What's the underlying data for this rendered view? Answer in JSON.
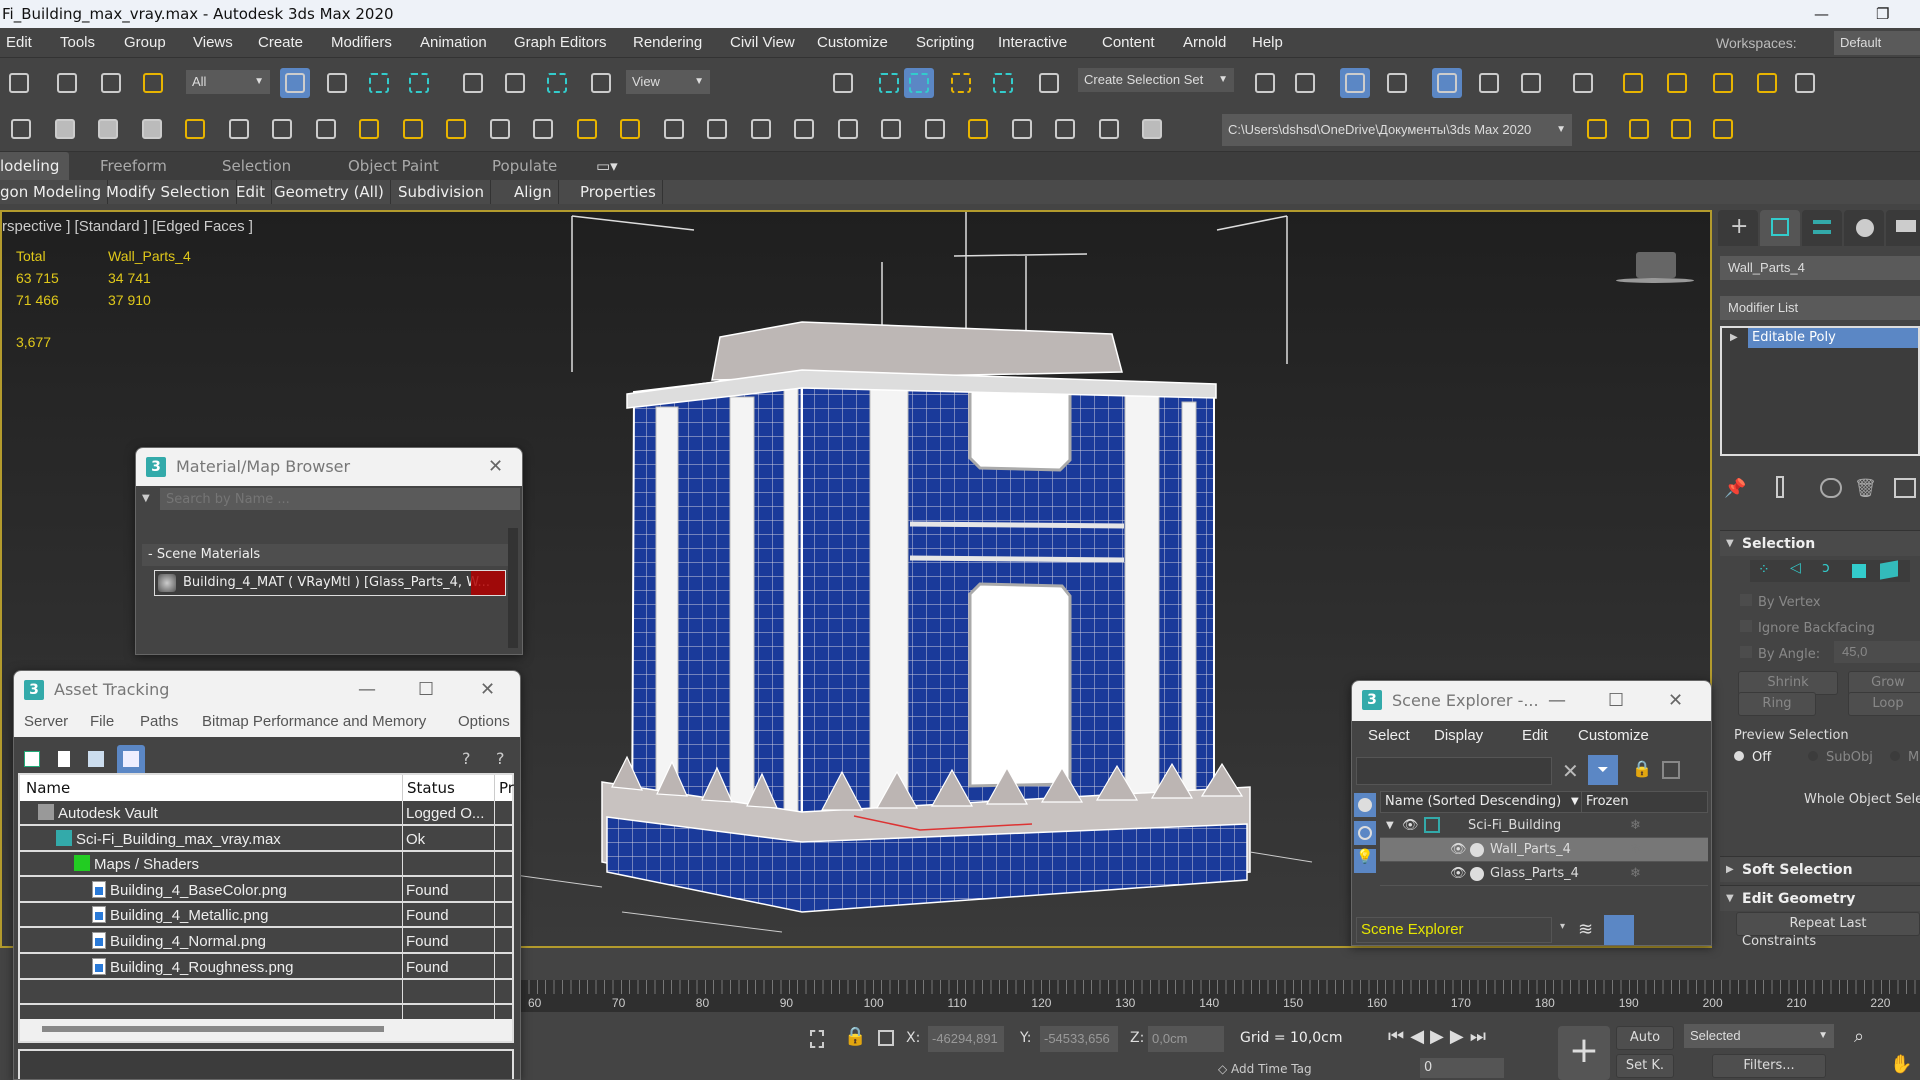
{
  "window": {
    "title": "Fi_Building_max_vray.max - Autodesk 3ds Max 2020",
    "minimize": "—",
    "restore": "❐"
  },
  "menu": [
    "Edit",
    "Tools",
    "Group",
    "Views",
    "Create",
    "Modifiers",
    "Animation",
    "Graph Editors",
    "Rendering",
    "Civil View",
    "Customize",
    "Scripting",
    "Interactive",
    "Content",
    "Arnold",
    "Help"
  ],
  "workspaces": {
    "label": "Workspaces:",
    "value": "Default"
  },
  "toolbar": {
    "selection_filter": "All",
    "ref_coord": "View",
    "named_selection": "Create Selection Set",
    "project_path": "C:\\Users\\dshsd\\OneDrive\\Документы\\3ds Max 2020",
    "row1_icons": [
      "redo-icon",
      "link-icon",
      "unlink-icon",
      "bind-space-warp-icon",
      "select-object-icon",
      "select-by-name-icon",
      "rect-selection-region-icon",
      "window-crossing-icon",
      "move-icon",
      "rotate-icon",
      "scale-icon",
      "placement-icon",
      "pivot-icon",
      "snaps-toggle-icon",
      "angle-snap-icon",
      "percent-snap-icon",
      "spinner-snap-icon",
      "edit-named-sets-icon",
      "mirror-icon",
      "align-icon",
      "scene-explorer-icon",
      "layer-explorer-icon",
      "ribbon-toggle-icon",
      "curve-editor-icon",
      "schematic-view-icon",
      "material-editor-icon",
      "render-setup-icon",
      "rendered-frame-window-icon",
      "render-icon",
      "render-cloud-icon",
      "viewport-layout-icon"
    ],
    "row2_icons": [
      "cloud-icon",
      "image-icon",
      "panel-icon",
      "grid-panel-icon",
      "light-lister-icon",
      "camera-icon",
      "camera-target-icon",
      "physical-camera-icon",
      "plane-light-icon",
      "dome-light-icon",
      "sphere-light-icon",
      "teapot-icon",
      "cone-icon",
      "sun-icon",
      "sphere-icon",
      "particles-icon",
      "fur-icon",
      "vray-mesh-icon",
      "proxy-icon",
      "vray-sky-icon",
      "vray-plane-icon",
      "scatter-icon",
      "sphere-material-icon",
      "convert-icon",
      "vray-object-icon",
      "clipboard-icon",
      "help-icon"
    ],
    "row2_right_icons": [
      "project-settings-icon",
      "project-folder-icon",
      "project-tree-icon",
      "project-structure-icon"
    ]
  },
  "ribbon": {
    "tabs": [
      "lodeling",
      "Freeform",
      "Selection",
      "Object Paint",
      "Populate"
    ],
    "active_tab": "lodeling",
    "subtabs": [
      "gon Modeling",
      "Modify Selection",
      "Edit",
      "Geometry (All)",
      "Subdivision",
      "Align",
      "Properties"
    ]
  },
  "viewport": {
    "label": "rspective ] [Standard ] [Edged Faces ]",
    "stats": {
      "col1_header": "Total",
      "col2_header": "Wall_Parts_4",
      "polys_total": "63 715",
      "polys_selected": "34 741",
      "verts_total": "71 466",
      "verts_selected": "37 910",
      "fps": "3,677"
    },
    "accent": "#b39b2d",
    "stats_color": "#e0c81a",
    "glass_color": "#1a3a9a"
  },
  "command_panel": {
    "object_name": "Wall_Parts_4",
    "modifier_list": "Modifier List",
    "stack": [
      "Editable Poly"
    ],
    "rollouts": {
      "selection": "Selection",
      "by_vertex": "By Vertex",
      "ignore_backfacing": "Ignore Backfacing",
      "by_angle": "By Angle:",
      "angle_value": "45,0",
      "shrink": "Shrink",
      "grow": "Grow",
      "ring": "Ring",
      "loop": "Loop",
      "preview_selection": "Preview Selection",
      "off": "Off",
      "subobj": "SubObj",
      "multi": "M",
      "whole_object": "Whole Object Sele",
      "soft_selection": "Soft Selection",
      "edit_geometry": "Edit Geometry",
      "repeat_last": "Repeat Last",
      "constraints": "Constraints"
    }
  },
  "material_browser": {
    "title": "Material/Map Browser",
    "search_placeholder": "Search by Name ...",
    "group": "- Scene Materials",
    "item": "Building_4_MAT  ( VRayMtl )  [Glass_Parts_4, W..."
  },
  "asset_tracking": {
    "title": "Asset Tracking",
    "menu": [
      "Server",
      "File",
      "Paths",
      "Bitmap Performance and Memory",
      "Options"
    ],
    "columns": [
      "Name",
      "Status",
      "Pr"
    ],
    "rows": [
      {
        "name": "Autodesk Vault",
        "status": "Logged O...",
        "indent": 1,
        "icon": "vault-icon"
      },
      {
        "name": "Sci-Fi_Building_max_vray.max",
        "status": "Ok",
        "indent": 2,
        "icon": "max-file-icon"
      },
      {
        "name": "Maps / Shaders",
        "status": "",
        "indent": 3,
        "icon": "maps-icon"
      },
      {
        "name": "Building_4_BaseColor.png",
        "status": "Found",
        "indent": 4,
        "icon": "image-file-icon"
      },
      {
        "name": "Building_4_Metallic.png",
        "status": "Found",
        "indent": 4,
        "icon": "image-file-icon"
      },
      {
        "name": "Building_4_Normal.png",
        "status": "Found",
        "indent": 4,
        "icon": "image-file-icon"
      },
      {
        "name": "Building_4_Roughness.png",
        "status": "Found",
        "indent": 4,
        "icon": "image-file-icon"
      }
    ]
  },
  "scene_explorer": {
    "title": "Scene Explorer -...",
    "menu": [
      "Select",
      "Display",
      "Edit",
      "Customize"
    ],
    "col_name": "Name (Sorted Descending)",
    "col_frozen": "Frozen",
    "items": [
      {
        "name": "Sci-Fi_Building",
        "level": 0,
        "selected": false
      },
      {
        "name": "Wall_Parts_4",
        "level": 1,
        "selected": true
      },
      {
        "name": "Glass_Parts_4",
        "level": 1,
        "selected": false
      }
    ],
    "footer": "Scene Explorer"
  },
  "timeline": {
    "ticks": [
      60,
      70,
      80,
      90,
      100,
      110,
      120,
      130,
      140,
      150,
      160,
      170,
      180,
      190,
      200,
      210,
      220
    ]
  },
  "status": {
    "x_label": "X:",
    "x": "-46294,891",
    "y_label": "Y:",
    "y": "-54533,656",
    "z_label": "Z:",
    "z": "0,0cm",
    "grid": "Grid = 10,0cm",
    "add_time_tag": "Add Time Tag",
    "frame": "0",
    "auto": "Auto",
    "set_key": "Set K.",
    "key_filter": "Selected",
    "filters": "Filters..."
  }
}
